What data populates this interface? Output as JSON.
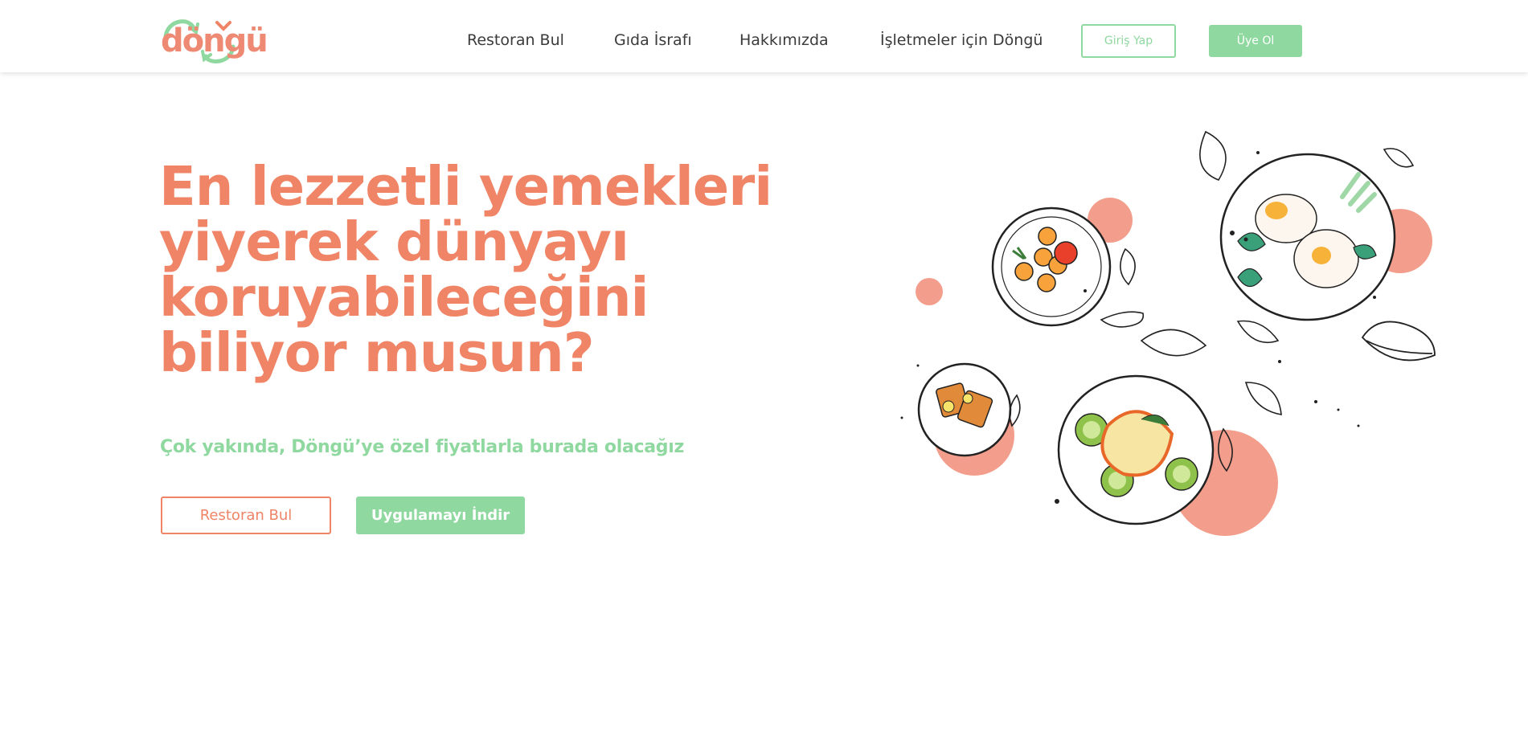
{
  "header": {
    "logo_text": "döngü",
    "nav": [
      {
        "label": "Restoran Bul"
      },
      {
        "label": "Gıda İsrafı"
      },
      {
        "label": "Hakkımızda"
      },
      {
        "label": "İşletmeler için Döngü"
      }
    ],
    "login_label": "Giriş Yap",
    "signup_label": "Üye Ol"
  },
  "hero": {
    "title": "En lezzetli yemekleri yiyerek dünyayı koruyabileceğini biliyor musun?",
    "subtitle": "Çok yakında, Döngü’ye özel fiyatlarla burada olacağız",
    "find_button": "Restoran Bul",
    "download_button": "Uygulamayı İndir"
  },
  "colors": {
    "brand_orange": "#ef8466",
    "brand_green": "#8fd8a0",
    "accent_circle": "#f39e8c"
  }
}
